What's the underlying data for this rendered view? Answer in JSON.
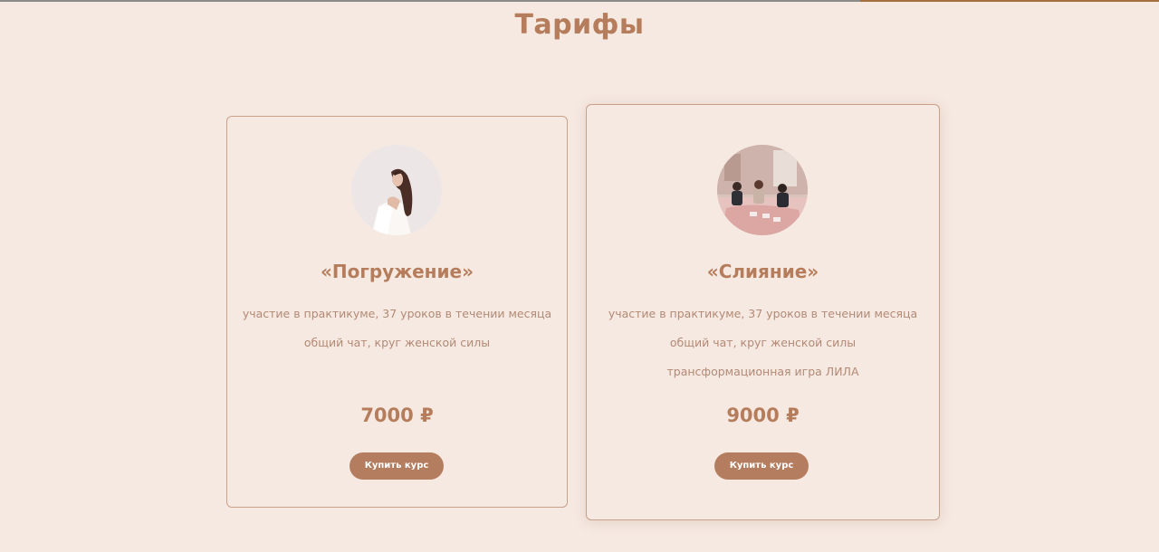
{
  "page": {
    "section_title": "Тарифы"
  },
  "tariffs": [
    {
      "title": "«Погружение»",
      "avatar_icon": "woman-portrait-photo",
      "features": [
        "участие в практикуме, 37 уроков в течении месяца",
        "общий чат, круг женской силы"
      ],
      "price": "7000 ₽",
      "button_label": "Купить курс"
    },
    {
      "title": "«Слияние»",
      "avatar_icon": "group-of-women-photo",
      "features": [
        "участие в практикуме, 37 уроков в течении месяца",
        "общий чат, круг женской силы",
        "трансформационная игра ЛИЛА"
      ],
      "price": "9000 ₽",
      "button_label": "Купить курс"
    }
  ],
  "colors": {
    "background": "#f6e9e1",
    "accent": "#b57d5c",
    "button": "#b47d5f",
    "muted_text": "#b28a76",
    "card_border": "#c9a08a"
  }
}
